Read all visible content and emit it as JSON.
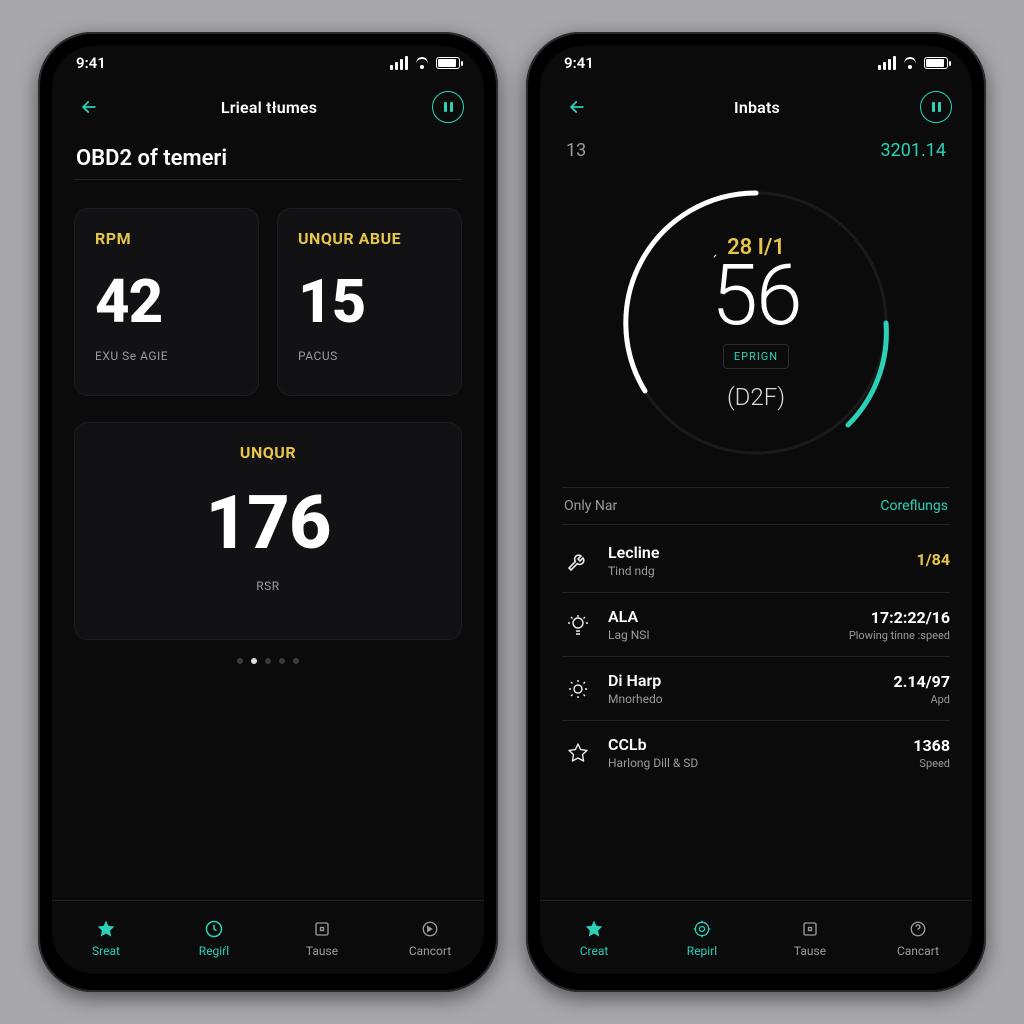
{
  "status": {
    "time": "9:41"
  },
  "screenA": {
    "title": "Lrieal tłumes",
    "heading": "OBD2 of temeri",
    "cards": [
      {
        "label": "RPM",
        "value": "42",
        "sub": "EXU Se AGIE"
      },
      {
        "label": "UNQUR ABUE",
        "value": "15",
        "sub": "PACUS"
      }
    ],
    "bigCard": {
      "label": "UNQUR",
      "value": "176",
      "sub": "RSR"
    }
  },
  "screenB": {
    "title": "Inbats",
    "topLeft": "13",
    "topRight": "3201.14",
    "gauge": {
      "top": "28 I/1",
      "value": "56",
      "badge": "EPRIGN",
      "sub": "(D2F)"
    },
    "tabs": {
      "left": "Only Nar",
      "right": "Coreflungs"
    },
    "rows": [
      {
        "t1": "Lecline",
        "t2": "Tind ndg",
        "v1": "1/84",
        "v1y": true,
        "v2": ""
      },
      {
        "t1": "ALA",
        "t2": "Lag NSI",
        "v1": "17:2:22/16",
        "v2": "Plowing tinne :speed"
      },
      {
        "t1": "Di Harp",
        "t2": "Mnorhedo",
        "v1": "2.14/97",
        "v2": "Apd"
      },
      {
        "t1": "CCLb",
        "t2": "Harlong Dill & SD",
        "v1": "1368",
        "v2": "Speed"
      }
    ]
  },
  "nav": {
    "items": [
      {
        "label": "Sreat"
      },
      {
        "label": "Regiŕl"
      },
      {
        "label": "Tause"
      },
      {
        "label": "Cancort"
      }
    ],
    "itemsB": [
      {
        "label": "Creat"
      },
      {
        "label": "Repirl"
      },
      {
        "label": "Tause"
      },
      {
        "label": "Cancart"
      }
    ]
  }
}
